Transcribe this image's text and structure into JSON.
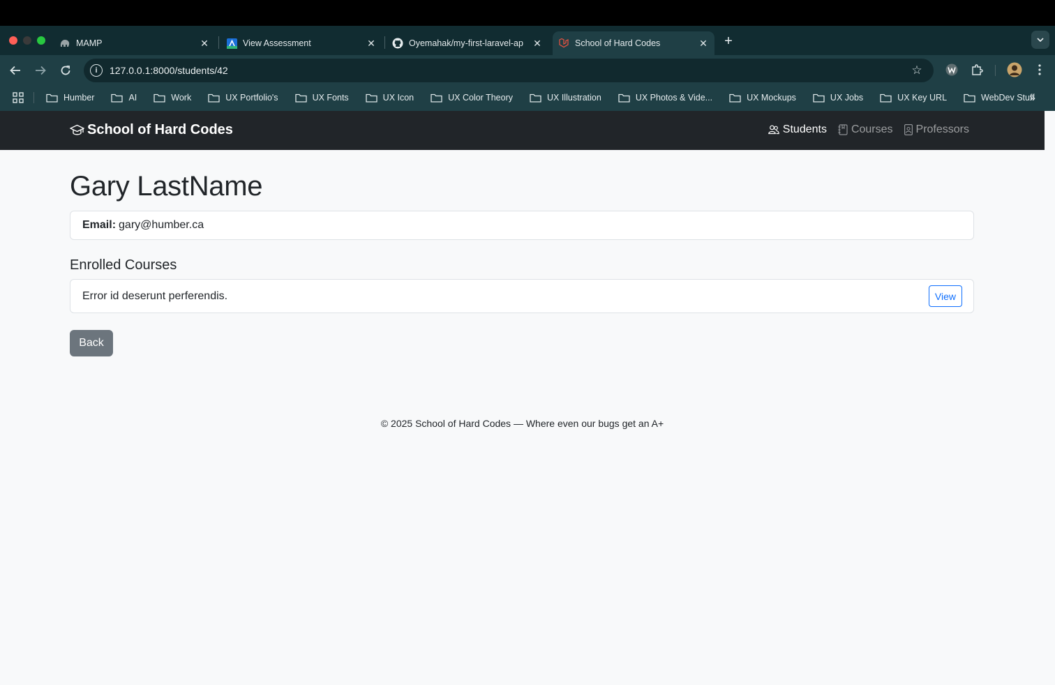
{
  "browser": {
    "tabs": [
      {
        "title": "MAMP",
        "favicon": "mamp-elephant-icon"
      },
      {
        "title": "View Assessment",
        "favicon": "app-icon"
      },
      {
        "title": "Oyemahak/my-first-laravel-ap",
        "favicon": "github-icon"
      },
      {
        "title": "School of Hard Codes",
        "favicon": "laravel-icon",
        "active": true
      }
    ],
    "url": "127.0.0.1:8000/students/42",
    "bookmarks": [
      "Humber",
      "AI",
      "Work",
      "UX Portfolio's",
      "UX Fonts",
      "UX Icon",
      "UX Color Theory",
      "UX Illustration",
      "UX Photos & Vide...",
      "UX Mockups",
      "UX Jobs",
      "UX Key URL",
      "WebDev Stuff"
    ]
  },
  "site": {
    "brand": "School of Hard Codes",
    "nav": {
      "students": "Students",
      "courses": "Courses",
      "professors": "Professors"
    }
  },
  "student": {
    "name": "Gary LastName",
    "email_label": "Email:",
    "email": "gary@humber.ca"
  },
  "enrolled": {
    "title": "Enrolled Courses",
    "courses": [
      {
        "name": "Error id deserunt perferendis.",
        "action": "View"
      }
    ]
  },
  "back_label": "Back",
  "footer": "© 2025 School of Hard Codes — Where even our bugs get an A+",
  "colors": {
    "navbar": "#212529",
    "primary": "#0d6efd",
    "secondary": "#6c757d",
    "page_bg": "#f8f9fa"
  }
}
